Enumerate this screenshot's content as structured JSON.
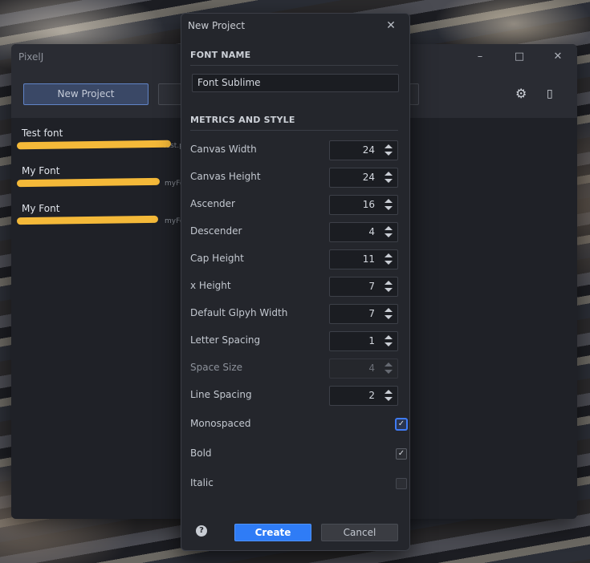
{
  "main_window": {
    "title": "PixelJ",
    "toolbar": {
      "new_project_label": "New Project"
    },
    "projects": [
      {
        "name": "Test font",
        "path_visible": "test.p"
      },
      {
        "name": "My Font",
        "path_visible": "myFo"
      },
      {
        "name": "My Font",
        "path_visible": "myFo"
      }
    ],
    "highlight_color": "#f4b939"
  },
  "dialog": {
    "title": "New Project",
    "font_name_section": "FONT NAME",
    "font_name_value": "Font Sublime",
    "metrics_section": "METRICS AND STYLE",
    "fields": [
      {
        "label": "Canvas Width",
        "value": "24"
      },
      {
        "label": "Canvas Height",
        "value": "24"
      },
      {
        "label": "Ascender",
        "value": "16"
      },
      {
        "label": "Descender",
        "value": "4"
      },
      {
        "label": "Cap Height",
        "value": "11"
      },
      {
        "label": "x Height",
        "value": "7"
      },
      {
        "label": "Default Glpyh Width",
        "value": "7"
      },
      {
        "label": "Letter Spacing",
        "value": "1"
      },
      {
        "label": "Space Size",
        "value": "4",
        "disabled": true
      },
      {
        "label": "Line Spacing",
        "value": "2"
      }
    ],
    "checkboxes": [
      {
        "label": "Monospaced",
        "checked": true,
        "focused": true
      },
      {
        "label": "Bold",
        "checked": true
      },
      {
        "label": "Italic",
        "checked": false
      }
    ],
    "help_glyph": "?",
    "create_label": "Create",
    "cancel_label": "Cancel",
    "accent_color": "#2f7cf6"
  }
}
